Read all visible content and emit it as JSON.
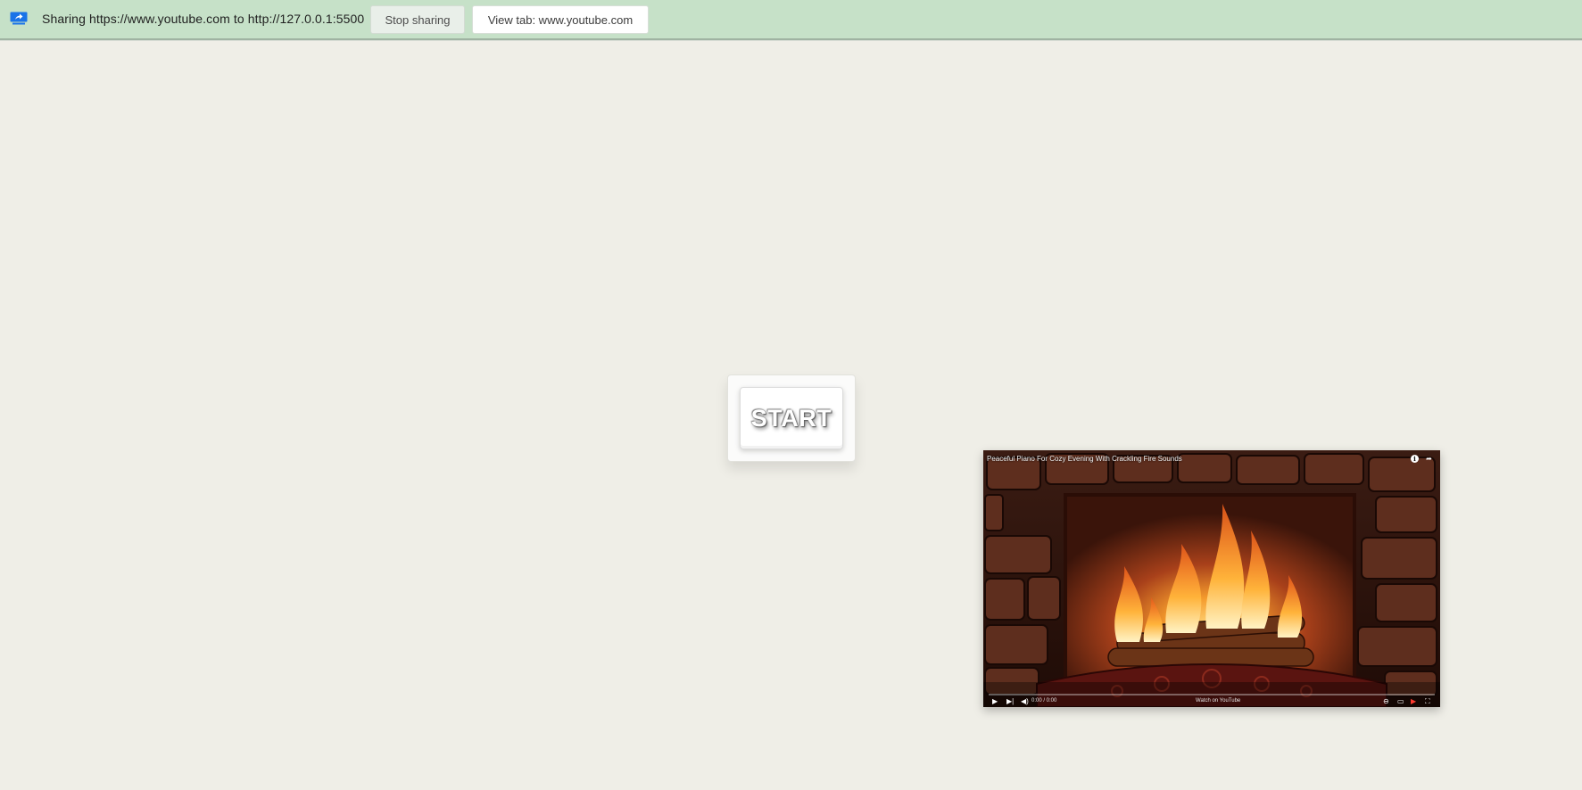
{
  "infobar": {
    "icon": "screen-share-icon",
    "share_text": "Sharing https://www.youtube.com to http://127.0.0.1:5500",
    "stop_label": "Stop sharing",
    "view_label": "View tab: www.youtube.com",
    "background_color": "#c6e1c8",
    "icon_color": "#1a73e8"
  },
  "main": {
    "background_color": "#efeee7",
    "start_label": "START"
  },
  "video": {
    "title": "Peaceful Piano For Cozy Evening With Crackling Fire Sounds",
    "time": "0:00 / 0:00",
    "chapter": "Watch on YouTube",
    "icons": [
      "info-icon",
      "share-icon",
      "play-icon",
      "next-icon",
      "volume-icon",
      "autoplay-toggle-icon",
      "captions-icon",
      "youtube-logo-icon",
      "fullscreen-icon"
    ]
  }
}
